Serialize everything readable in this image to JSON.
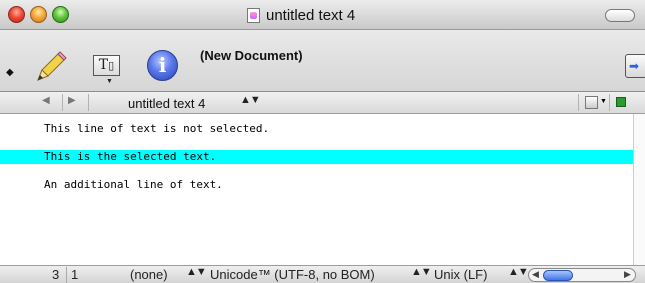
{
  "window": {
    "title": "untitled text 4"
  },
  "toolbar": {
    "document_status": "(New Document)",
    "t_label": "T",
    "info_glyph": "i",
    "diamond_glyph": "◆",
    "popup_arrow": "▼"
  },
  "navbar": {
    "back_glyph": "◀",
    "forward_glyph": "▶",
    "file_name": "untitled text 4",
    "updown_glyph": "▲▼"
  },
  "editor": {
    "lines": [
      "This line of text is not selected.",
      "This is the selected text.",
      "An additional line of text."
    ],
    "selected_line_index": 1,
    "selection_color": "#00ffff"
  },
  "statusbar": {
    "line_number": "3",
    "column_number": "1",
    "language": "(none)",
    "encoding": "Unicode™ (UTF-8, no BOM)",
    "line_endings": "Unix (LF)",
    "updown_glyph": "▲▼",
    "left_glyph": "◀",
    "right_glyph": "▶"
  },
  "icons": {
    "toolbar": [
      "pencil-icon",
      "text-options-icon",
      "info-icon",
      "document-drawer-icon"
    ],
    "navbar": [
      "bookmark-icon",
      "document-status-icon"
    ]
  }
}
